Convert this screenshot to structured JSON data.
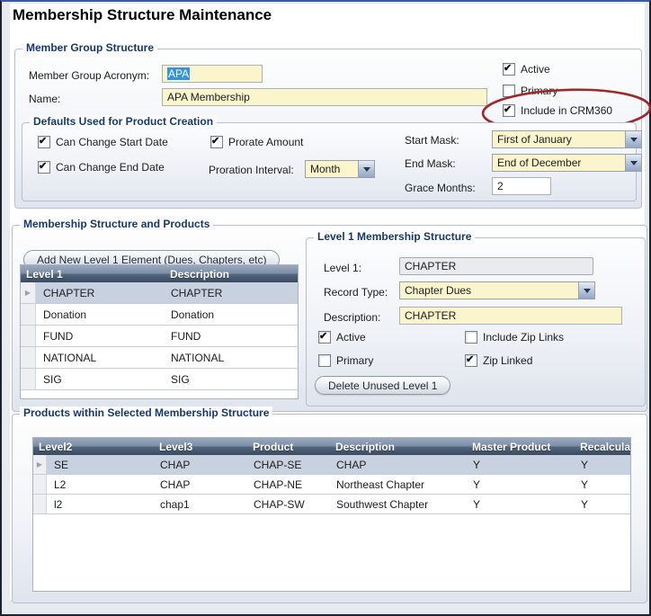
{
  "title": "Membership Structure Maintenance",
  "colors": {
    "annotation_red": "#9e282c",
    "field_yellow": "#fbf5ce",
    "selection_blue": "#3194e4",
    "legend_navy": "#17386e",
    "grid_header_dark": "#3a4a60",
    "selected_row": "#c7d1e0"
  },
  "member_group": {
    "legend": "Member Group Structure",
    "acronym": {
      "label": "Member Group Acronym:",
      "value": "APA"
    },
    "name": {
      "label": "Name:",
      "value": "APA Membership"
    },
    "active": {
      "label": "Active",
      "checked": true
    },
    "primary": {
      "label": "Primary",
      "checked": false
    },
    "include_crm360": {
      "label": "Include in CRM360",
      "checked": true
    },
    "defaults": {
      "legend": "Defaults Used for Product Creation",
      "can_change_start_date": {
        "label": "Can Change Start Date",
        "checked": true
      },
      "can_change_end_date": {
        "label": "Can Change End Date",
        "checked": true
      },
      "prorate_amount": {
        "label": "Prorate Amount",
        "checked": true
      },
      "proration_interval": {
        "label": "Proration Interval:",
        "value": "Month"
      },
      "start_mask": {
        "label": "Start Mask:",
        "value": "First of January"
      },
      "end_mask": {
        "label": "End Mask:",
        "value": "End of December"
      },
      "grace_months": {
        "label": "Grace Months:",
        "value": "2"
      }
    }
  },
  "structure_section": {
    "legend": "Membership Structure and Products",
    "add_level1_button": "Add New Level 1 Element (Dues, Chapters, etc)",
    "level1_grid": {
      "columns": [
        "Level 1",
        "Description"
      ],
      "selected_index": 0,
      "rows": [
        [
          "CHAPTER",
          "CHAPTER"
        ],
        [
          "Donation",
          "Donation"
        ],
        [
          "FUND",
          "FUND"
        ],
        [
          "NATIONAL",
          "NATIONAL"
        ],
        [
          "SIG",
          "SIG"
        ]
      ]
    },
    "level1_panel": {
      "legend": "Level 1 Membership Structure",
      "level1": {
        "label": "Level 1:",
        "value": "CHAPTER"
      },
      "record_type": {
        "label": "Record Type:",
        "value": "Chapter Dues"
      },
      "description": {
        "label": "Description:",
        "value": "CHAPTER"
      },
      "active": {
        "label": "Active",
        "checked": true
      },
      "include_zip_links": {
        "label": "Include Zip Links",
        "checked": false
      },
      "primary": {
        "label": "Primary",
        "checked": false
      },
      "zip_linked": {
        "label": "Zip Linked",
        "checked": true
      },
      "delete_button": "Delete Unused Level 1"
    }
  },
  "products_section": {
    "legend": "Products within Selected Membership Structure",
    "grid": {
      "columns": [
        "Level2",
        "Level3",
        "Product",
        "Description",
        "Master Product",
        "Recalculate"
      ],
      "selected_index": 0,
      "rows": [
        [
          "SE",
          "CHAP",
          "CHAP-SE",
          "CHAP",
          "Y",
          "Y"
        ],
        [
          "L2",
          "CHAP",
          "CHAP-NE",
          "Northeast Chapter",
          "Y",
          "Y"
        ],
        [
          "l2",
          "chap1",
          "CHAP-SW",
          "Southwest Chapter",
          "Y",
          "Y"
        ]
      ]
    }
  },
  "annotation": {
    "color": "#9e282c"
  }
}
